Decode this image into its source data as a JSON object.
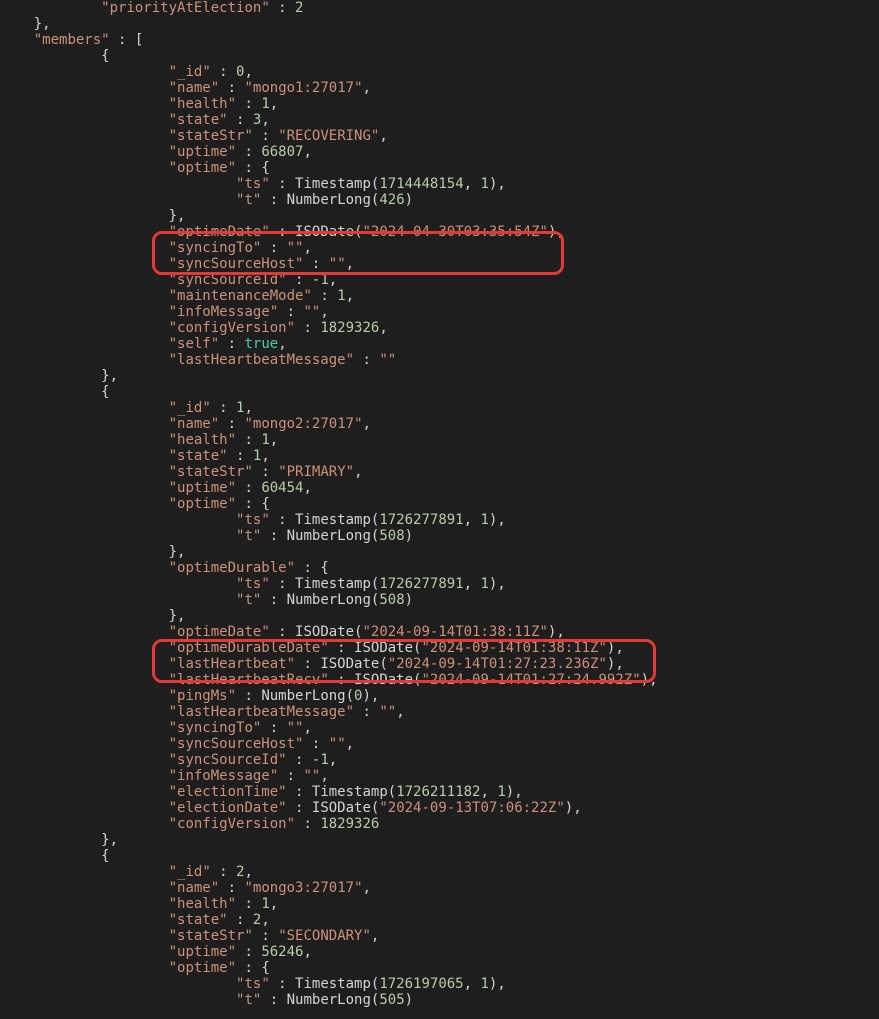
{
  "header": {
    "priorityAtElectionKey": "priorityAtElection",
    "priorityAtElectionVal": "2",
    "membersKey": "members"
  },
  "m0": {
    "idKey": "_id",
    "idVal": "0",
    "nameKey": "name",
    "nameVal": "mongo1:27017",
    "healthKey": "health",
    "healthVal": "1",
    "stateKey": "state",
    "stateVal": "3",
    "stateStrKey": "stateStr",
    "stateStrVal": "RECOVERING",
    "uptimeKey": "uptime",
    "uptimeVal": "66807",
    "optimeKey": "optime",
    "tsKey": "ts",
    "tsCall": "Timestamp(",
    "tsA": "1714448154",
    "tsB": "1",
    "tKey": "t",
    "tCall": "NumberLong(",
    "tVal": "426",
    "optimeDateKey": "optimeDate",
    "optimeDateCall": "ISODate(",
    "optimeDateVal": "2024-04-30T03:35:54Z",
    "syncingToKey": "syncingTo",
    "syncingToVal": "",
    "syncSourceHostKey": "syncSourceHost",
    "syncSourceHostVal": "",
    "syncSourceIdKey": "syncSourceId",
    "syncSourceIdVal": "-1",
    "maintenanceModeKey": "maintenanceMode",
    "maintenanceModeVal": "1",
    "infoMessageKey": "infoMessage",
    "infoMessageVal": "",
    "configVersionKey": "configVersion",
    "configVersionVal": "1829326",
    "selfKey": "self",
    "selfVal": "true",
    "lastHbMsgKey": "lastHeartbeatMessage",
    "lastHbMsgVal": ""
  },
  "m1": {
    "idKey": "_id",
    "idVal": "1",
    "nameKey": "name",
    "nameVal": "mongo2:27017",
    "healthKey": "health",
    "healthVal": "1",
    "stateKey": "state",
    "stateVal": "1",
    "stateStrKey": "stateStr",
    "stateStrVal": "PRIMARY",
    "uptimeKey": "uptime",
    "uptimeVal": "60454",
    "optimeKey": "optime",
    "tsKey": "ts",
    "tsCall": "Timestamp(",
    "tsA": "1726277891",
    "tsB": "1",
    "tKey": "t",
    "tCall": "NumberLong(",
    "tVal": "508",
    "optimeDurableKey": "optimeDurable",
    "tsKey2": "ts",
    "tsA2": "1726277891",
    "tsB2": "1",
    "tKey2": "t",
    "tVal2": "508",
    "optimeDateKey": "optimeDate",
    "optimeDateVal": "2024-09-14T01:38:11Z",
    "optimeDurableDateKey": "optimeDurableDate",
    "optimeDurableDateVal": "2024-09-14T01:38:11Z",
    "lastHbKey": "lastHeartbeat",
    "lastHbVal": "2024-09-14T01:27:23.236Z",
    "lastHbRecvKey": "lastHeartbeatRecv",
    "lastHbRecvVal": "2024-09-14T01:27:24.992Z",
    "pingMsKey": "pingMs",
    "pingMsCall": "NumberLong(",
    "pingMsVal": "0",
    "lastHbMsgKey": "lastHeartbeatMessage",
    "lastHbMsgVal": "",
    "syncingToKey": "syncingTo",
    "syncingToVal": "",
    "syncSourceHostKey": "syncSourceHost",
    "syncSourceHostVal": "",
    "syncSourceIdKey": "syncSourceId",
    "syncSourceIdVal": "-1",
    "infoMessageKey": "infoMessage",
    "infoMessageVal": "",
    "electionTimeKey": "electionTime",
    "electionTimeA": "1726211182",
    "electionTimeB": "1",
    "electionDateKey": "electionDate",
    "electionDateVal": "2024-09-13T07:06:22Z",
    "configVersionKey": "configVersion",
    "configVersionVal": "1829326"
  },
  "m2": {
    "idKey": "_id",
    "idVal": "2",
    "nameKey": "name",
    "nameVal": "mongo3:27017",
    "healthKey": "health",
    "healthVal": "1",
    "stateKey": "state",
    "stateVal": "2",
    "stateStrKey": "stateStr",
    "stateStrVal": "SECONDARY",
    "uptimeKey": "uptime",
    "uptimeVal": "56246",
    "optimeKey": "optime",
    "tsKey": "ts",
    "tsA": "1726197065",
    "tsB": "1",
    "tKey": "t",
    "tVal": "505"
  }
}
